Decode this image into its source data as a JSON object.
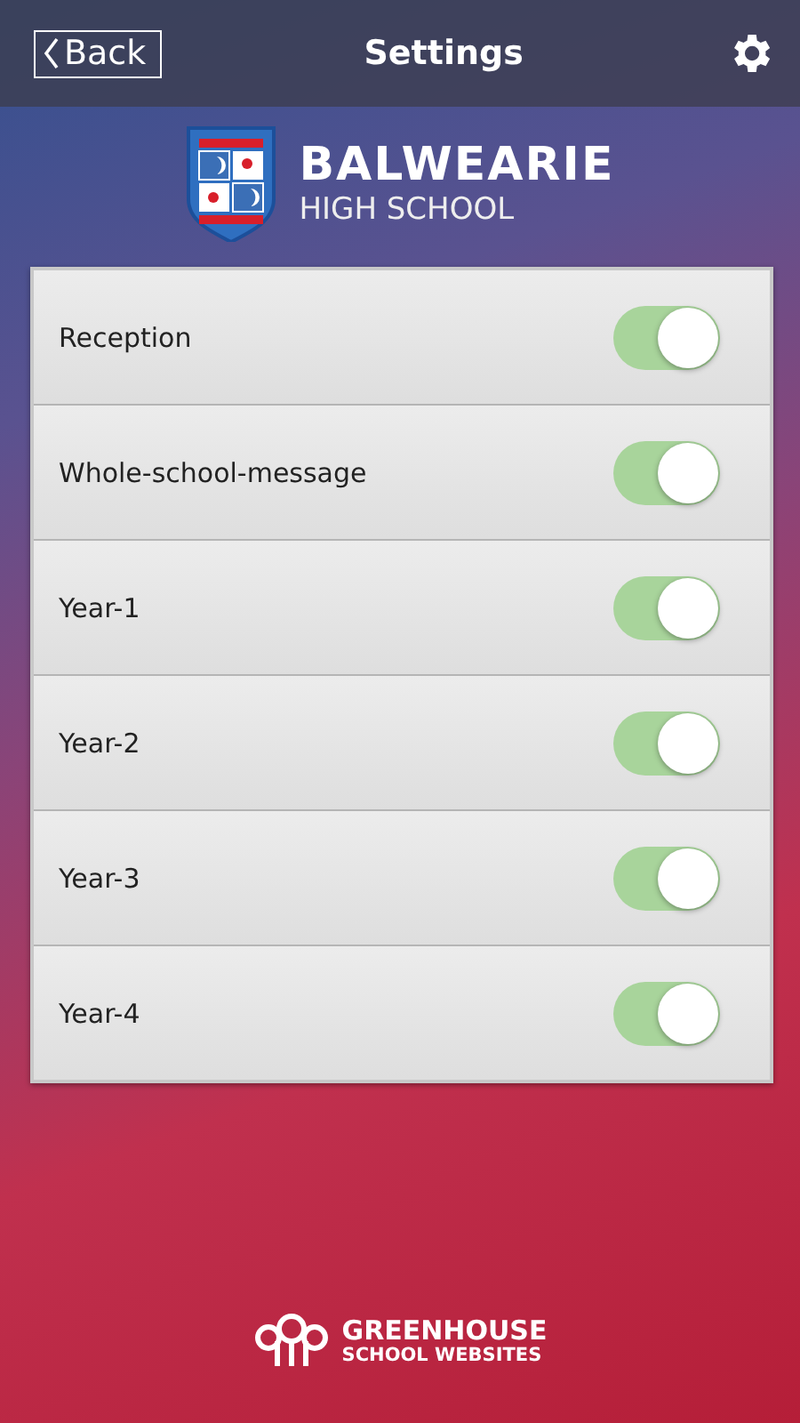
{
  "header": {
    "back": "Back",
    "title": "Settings"
  },
  "school": {
    "name": "BALWEARIE",
    "subtitle": "HIGH SCHOOL"
  },
  "groups": [
    {
      "label": "Reception",
      "on": true
    },
    {
      "label": "Whole-school-message",
      "on": true
    },
    {
      "label": "Year-1",
      "on": true
    },
    {
      "label": "Year-2",
      "on": true
    },
    {
      "label": "Year-3",
      "on": true
    },
    {
      "label": "Year-4",
      "on": true
    }
  ],
  "footer": {
    "line1": "GREENHOUSE",
    "line2": "SCHOOL WEBSITES"
  }
}
